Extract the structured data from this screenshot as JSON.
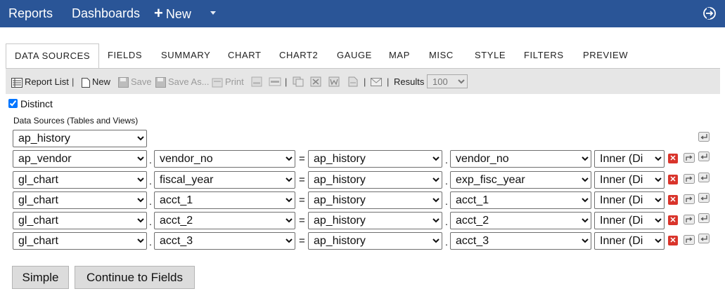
{
  "topnav": {
    "reports": "Reports",
    "dashboards": "Dashboards",
    "new": "New",
    "plus": "+"
  },
  "tabs": [
    "DATA SOURCES",
    "FIELDS",
    "SUMMARY",
    "CHART",
    "CHART2",
    "GAUGE",
    "MAP",
    "MISC",
    "STYLE",
    "FILTERS",
    "PREVIEW"
  ],
  "toolbar": {
    "report_list": "Report List",
    "new": "New",
    "save": "Save",
    "save_as": "Save As...",
    "print": "Print",
    "results_label": "Results",
    "results_value": "100",
    "separator": "|"
  },
  "distinct": {
    "label": "Distinct",
    "checked": true
  },
  "data_sources_label": "Data Sources (Tables and Views)",
  "first_source": "ap_history",
  "joins": [
    {
      "left_table": "ap_vendor",
      "left_field": "vendor_no",
      "right_table": "ap_history",
      "right_field": "vendor_no",
      "join_type": "Inner (Di"
    },
    {
      "left_table": "gl_chart",
      "left_field": "fiscal_year",
      "right_table": "ap_history",
      "right_field": "exp_fisc_year",
      "join_type": "Inner (Di"
    },
    {
      "left_table": "gl_chart",
      "left_field": "acct_1",
      "right_table": "ap_history",
      "right_field": "acct_1",
      "join_type": "Inner (Di"
    },
    {
      "left_table": "gl_chart",
      "left_field": "acct_2",
      "right_table": "ap_history",
      "right_field": "acct_2",
      "join_type": "Inner (Di"
    },
    {
      "left_table": "gl_chart",
      "left_field": "acct_3",
      "right_table": "ap_history",
      "right_field": "acct_3",
      "join_type": "Inner (Di"
    }
  ],
  "symbols": {
    "dot": ".",
    "eq": "=",
    "del": "✕"
  },
  "buttons": {
    "simple": "Simple",
    "continue": "Continue to Fields"
  },
  "colors": {
    "nav_bg": "#2a5597",
    "toolbar_bg": "#e6e6e6",
    "delete_red": "#d9342b"
  }
}
